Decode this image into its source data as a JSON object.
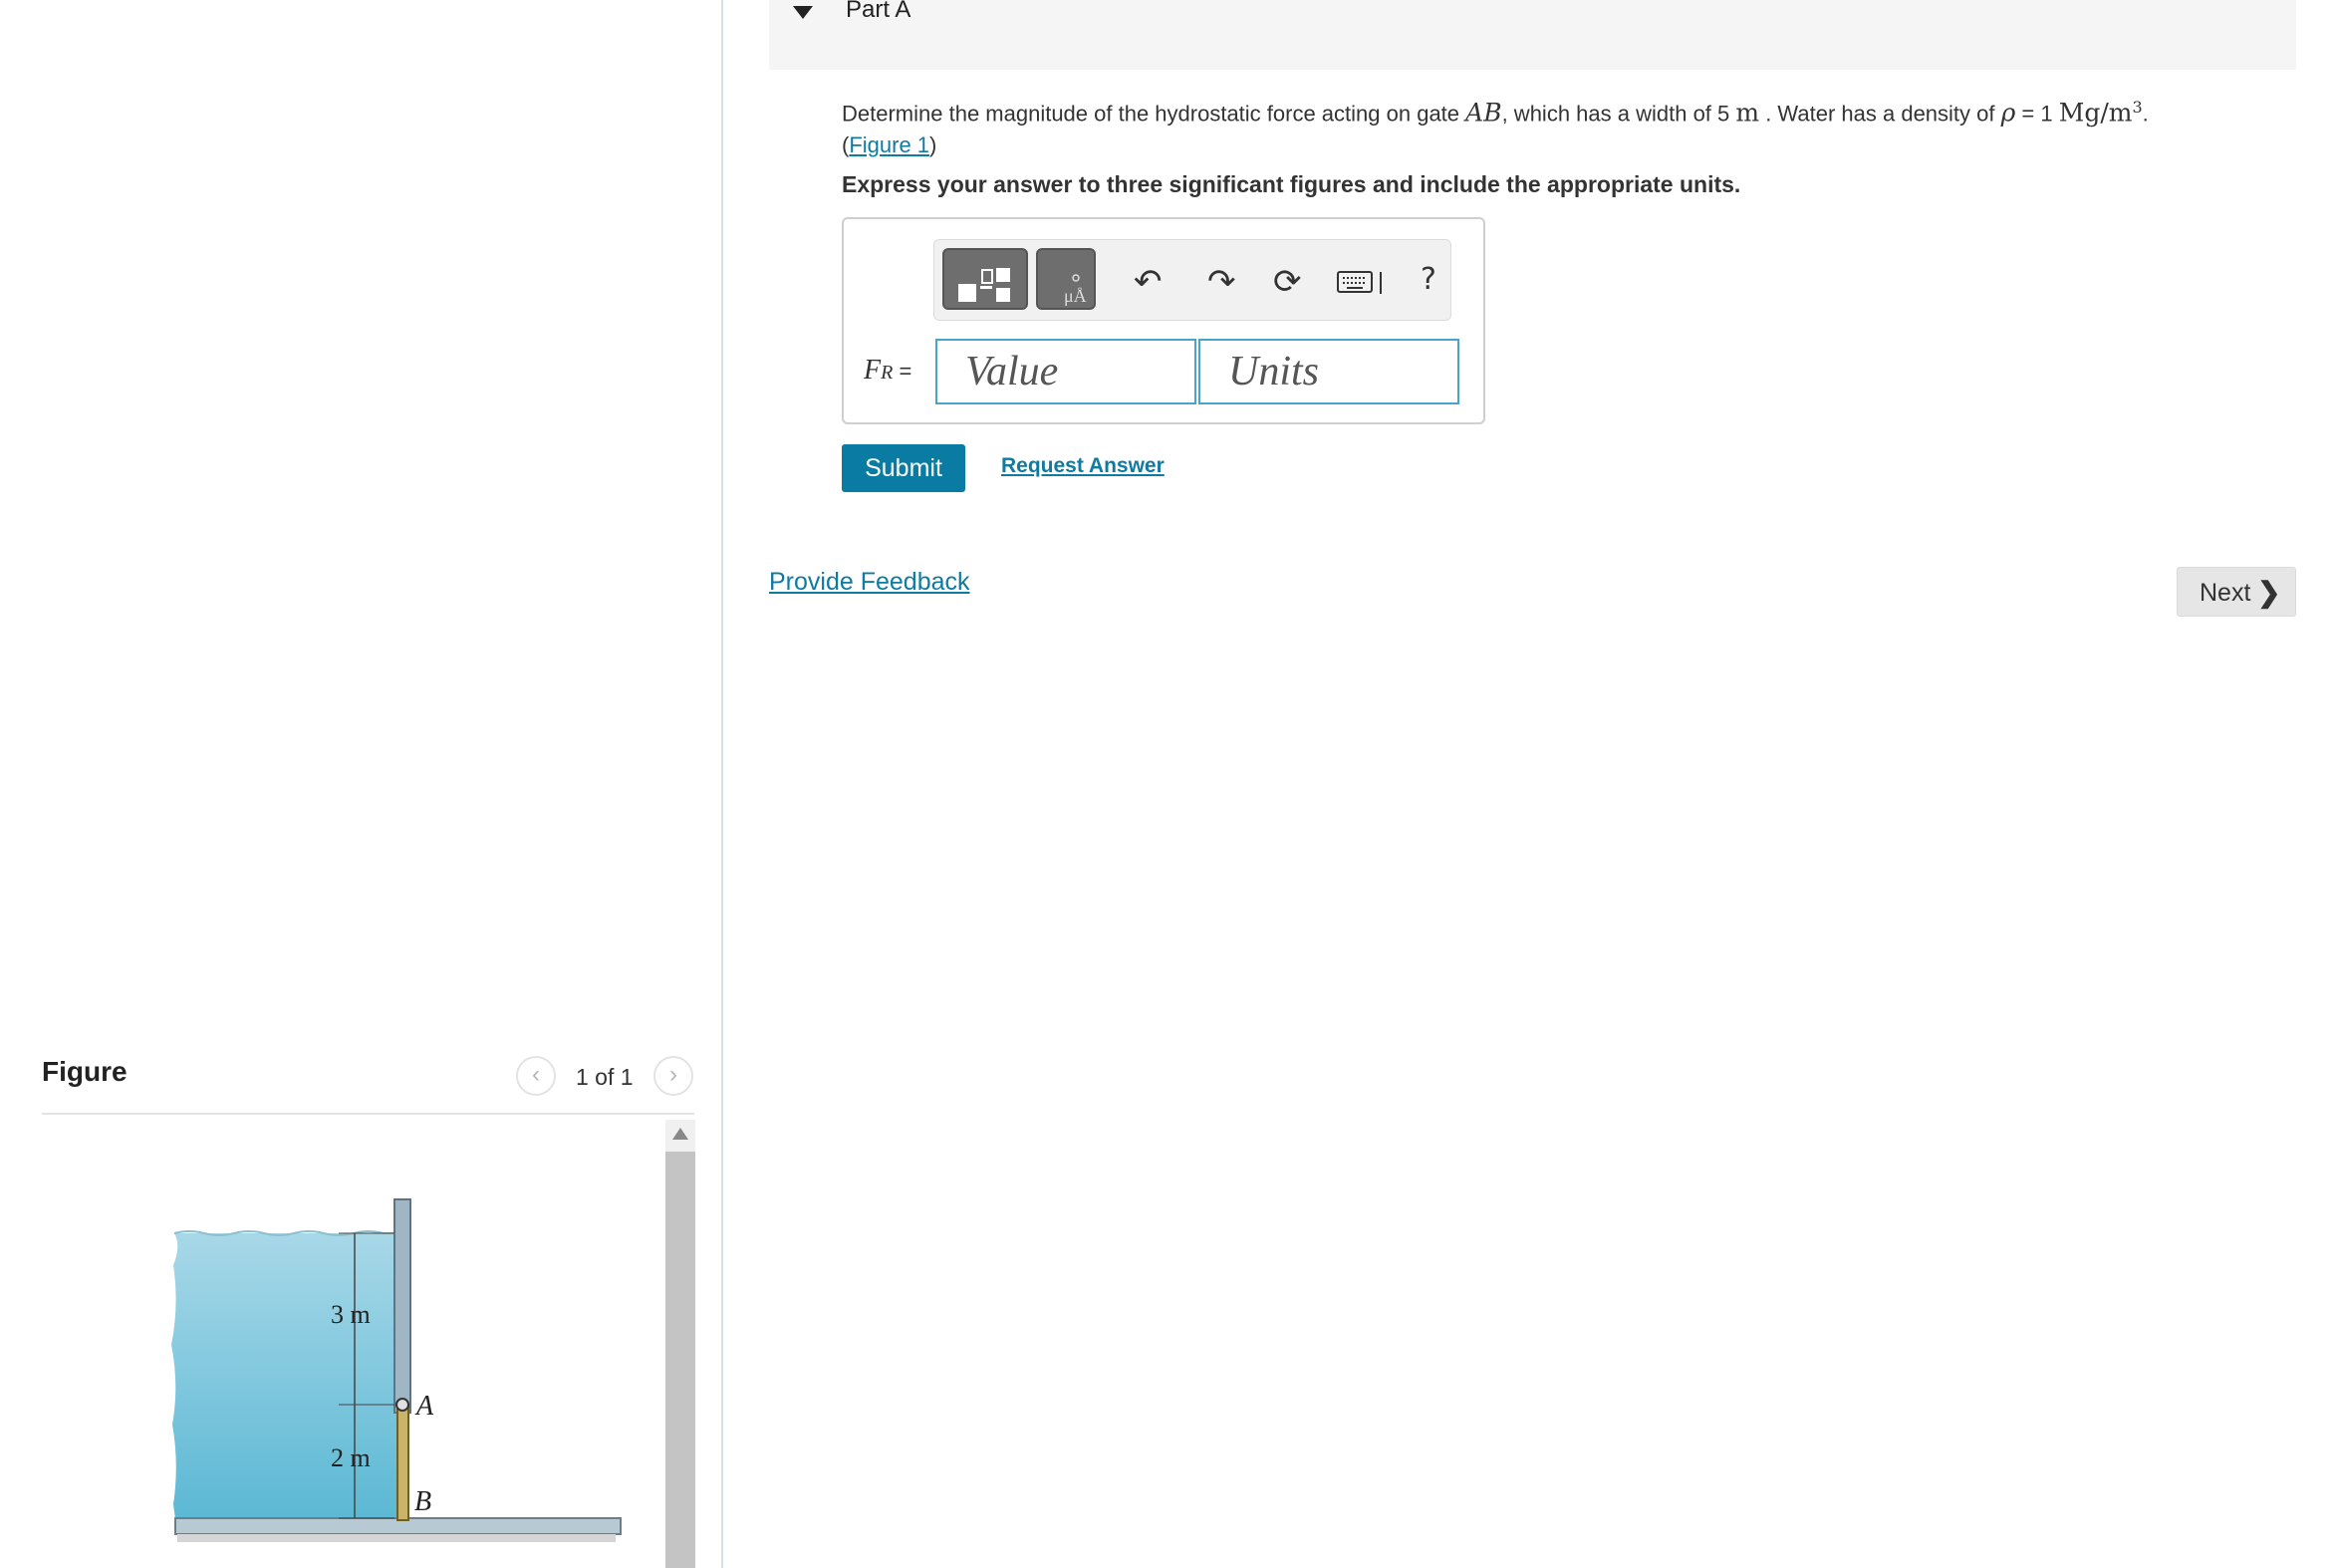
{
  "part": {
    "title": "Part A"
  },
  "problem": {
    "text_1": "Determine the magnitude of the hydrostatic force acting on gate ",
    "gate": "AB",
    "text_2": ", which has a width of 5 ",
    "width_unit": "m",
    "text_3": " . Water has a density of ",
    "rho": "ρ",
    "text_4": " = 1 ",
    "density_unit": "Mg/m",
    "density_exp": "3",
    "text_5": ".",
    "figure_open": "(",
    "figure_link": "Figure 1",
    "figure_close": ")"
  },
  "instruction": "Express your answer to three significant figures and include the appropriate units.",
  "answer": {
    "label_main": "F",
    "label_sub": "R",
    "label_eq": " =",
    "value_placeholder": "Value",
    "units_placeholder": "Units"
  },
  "toolbar": {
    "templates_icon": "templates-icon",
    "units_icon": "units-icon",
    "undo_icon": "undo-icon",
    "redo_icon": "redo-icon",
    "reset_icon": "reset-icon",
    "keyboard_icon": "keyboard-icon",
    "help_label": "?"
  },
  "actions": {
    "submit_label": "Submit",
    "request_answer_label": "Request Answer",
    "feedback_label": "Provide Feedback",
    "next_label": "Next"
  },
  "figure": {
    "title": "Figure",
    "pager_text": "1 of 1",
    "dimension_top": "3 m",
    "dimension_bottom": "2 m",
    "point_a": "A",
    "point_b": "B"
  },
  "colors": {
    "accent": "#0a7ca4",
    "link": "#0f7ba1",
    "water_top": "#a8d8e8",
    "water_bottom": "#5bb8d4"
  }
}
